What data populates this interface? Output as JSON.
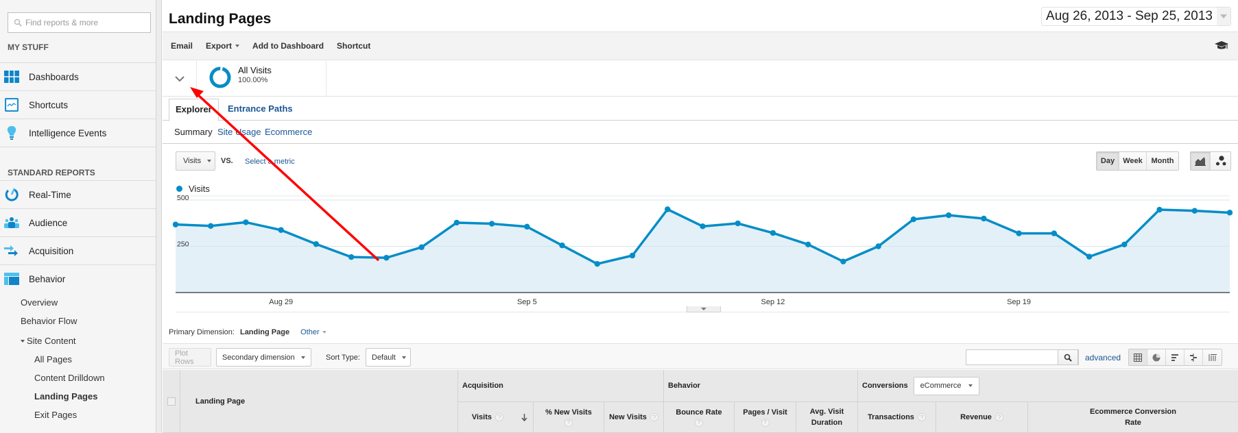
{
  "sidebar": {
    "search_placeholder": "Find reports & more",
    "my_stuff_title": "MY STUFF",
    "my_stuff": [
      {
        "label": "Dashboards",
        "icon": "dashboards-icon"
      },
      {
        "label": "Shortcuts",
        "icon": "shortcuts-icon"
      },
      {
        "label": "Intelligence Events",
        "icon": "lightbulb-icon"
      }
    ],
    "standard_reports_title": "STANDARD REPORTS",
    "standard_reports": [
      {
        "label": "Real-Time",
        "icon": "realtime-icon"
      },
      {
        "label": "Audience",
        "icon": "audience-icon"
      },
      {
        "label": "Acquisition",
        "icon": "acquisition-icon"
      },
      {
        "label": "Behavior",
        "icon": "behavior-icon"
      }
    ],
    "behavior_sub": [
      "Overview",
      "Behavior Flow"
    ],
    "site_content_label": "Site Content",
    "site_content_sub": [
      "All Pages",
      "Content Drilldown",
      "Landing Pages",
      "Exit Pages"
    ],
    "active_item": "Landing Pages"
  },
  "header": {
    "title": "Landing Pages",
    "date_range": "Aug 26, 2013 - Sep 25, 2013"
  },
  "toolbar": {
    "email": "Email",
    "export": "Export",
    "add_to_dashboard": "Add to Dashboard",
    "shortcut": "Shortcut"
  },
  "segment": {
    "name": "All Visits",
    "percent": "100.00%"
  },
  "tabs": [
    "Explorer",
    "Entrance Paths"
  ],
  "subtabs": [
    "Summary",
    "Site Usage",
    "Ecommerce"
  ],
  "chart_controls": {
    "metric": "Visits",
    "vs": "VS.",
    "select_metric": "Select a metric",
    "granularity": [
      "Day",
      "Week",
      "Month"
    ],
    "active_granularity": "Day"
  },
  "chart_data": {
    "type": "area",
    "title": "",
    "legend": [
      "Visits"
    ],
    "legend_position": "top-left",
    "xlabel": "",
    "ylabel": "",
    "ylim": [
      0,
      500
    ],
    "yticks": [
      250,
      500
    ],
    "grid": true,
    "x_tick_labels": [
      {
        "label": "Aug 29",
        "index": 3
      },
      {
        "label": "Sep 5",
        "index": 10
      },
      {
        "label": "Sep 12",
        "index": 17
      },
      {
        "label": "Sep 19",
        "index": 24
      }
    ],
    "x": [
      "Aug 26",
      "Aug 27",
      "Aug 28",
      "Aug 29",
      "Aug 30",
      "Aug 31",
      "Sep 1",
      "Sep 2",
      "Sep 3",
      "Sep 4",
      "Sep 5",
      "Sep 6",
      "Sep 7",
      "Sep 8",
      "Sep 9",
      "Sep 10",
      "Sep 11",
      "Sep 12",
      "Sep 13",
      "Sep 14",
      "Sep 15",
      "Sep 16",
      "Sep 17",
      "Sep 18",
      "Sep 19",
      "Sep 20",
      "Sep 21",
      "Sep 22",
      "Sep 23",
      "Sep 24",
      "Sep 25"
    ],
    "series": [
      {
        "name": "Visits",
        "color": "#058dc7",
        "values": [
          368,
          360,
          380,
          338,
          262,
          192,
          188,
          245,
          378,
          372,
          356,
          255,
          155,
          200,
          450,
          358,
          374,
          322,
          260,
          168,
          250,
          396,
          418,
          400,
          320,
          320,
          194,
          260,
          448,
          442,
          432
        ]
      }
    ]
  },
  "table_controls": {
    "primary_dimension_label": "Primary Dimension:",
    "primary_dimension_value": "Landing Page",
    "other": "Other",
    "plot_rows": "Plot Rows",
    "secondary_dimension": "Secondary dimension",
    "sort_type_label": "Sort Type:",
    "sort_type_value": "Default",
    "search_value": "",
    "advanced": "advanced"
  },
  "table": {
    "first_column": "Landing Page",
    "groups": {
      "acquisition": "Acquisition",
      "behavior": "Behavior",
      "conversions": "Conversions",
      "conversions_select": "eCommerce"
    },
    "columns": {
      "visits": "Visits",
      "pct_new_visits": "% New Visits",
      "new_visits": "New Visits",
      "bounce_rate": "Bounce Rate",
      "pages_visit": "Pages / Visit",
      "avg_visit_duration": "Avg. Visit Duration",
      "transactions": "Transactions",
      "revenue": "Revenue",
      "ecom_conv_rate": "Ecommerce Conversion Rate"
    },
    "help_glyph": "?"
  },
  "colors": {
    "accent": "#058dc7",
    "link": "#1a5694",
    "area_fill": "#e3f0f8",
    "annotation_arrow": "#ff0000"
  }
}
